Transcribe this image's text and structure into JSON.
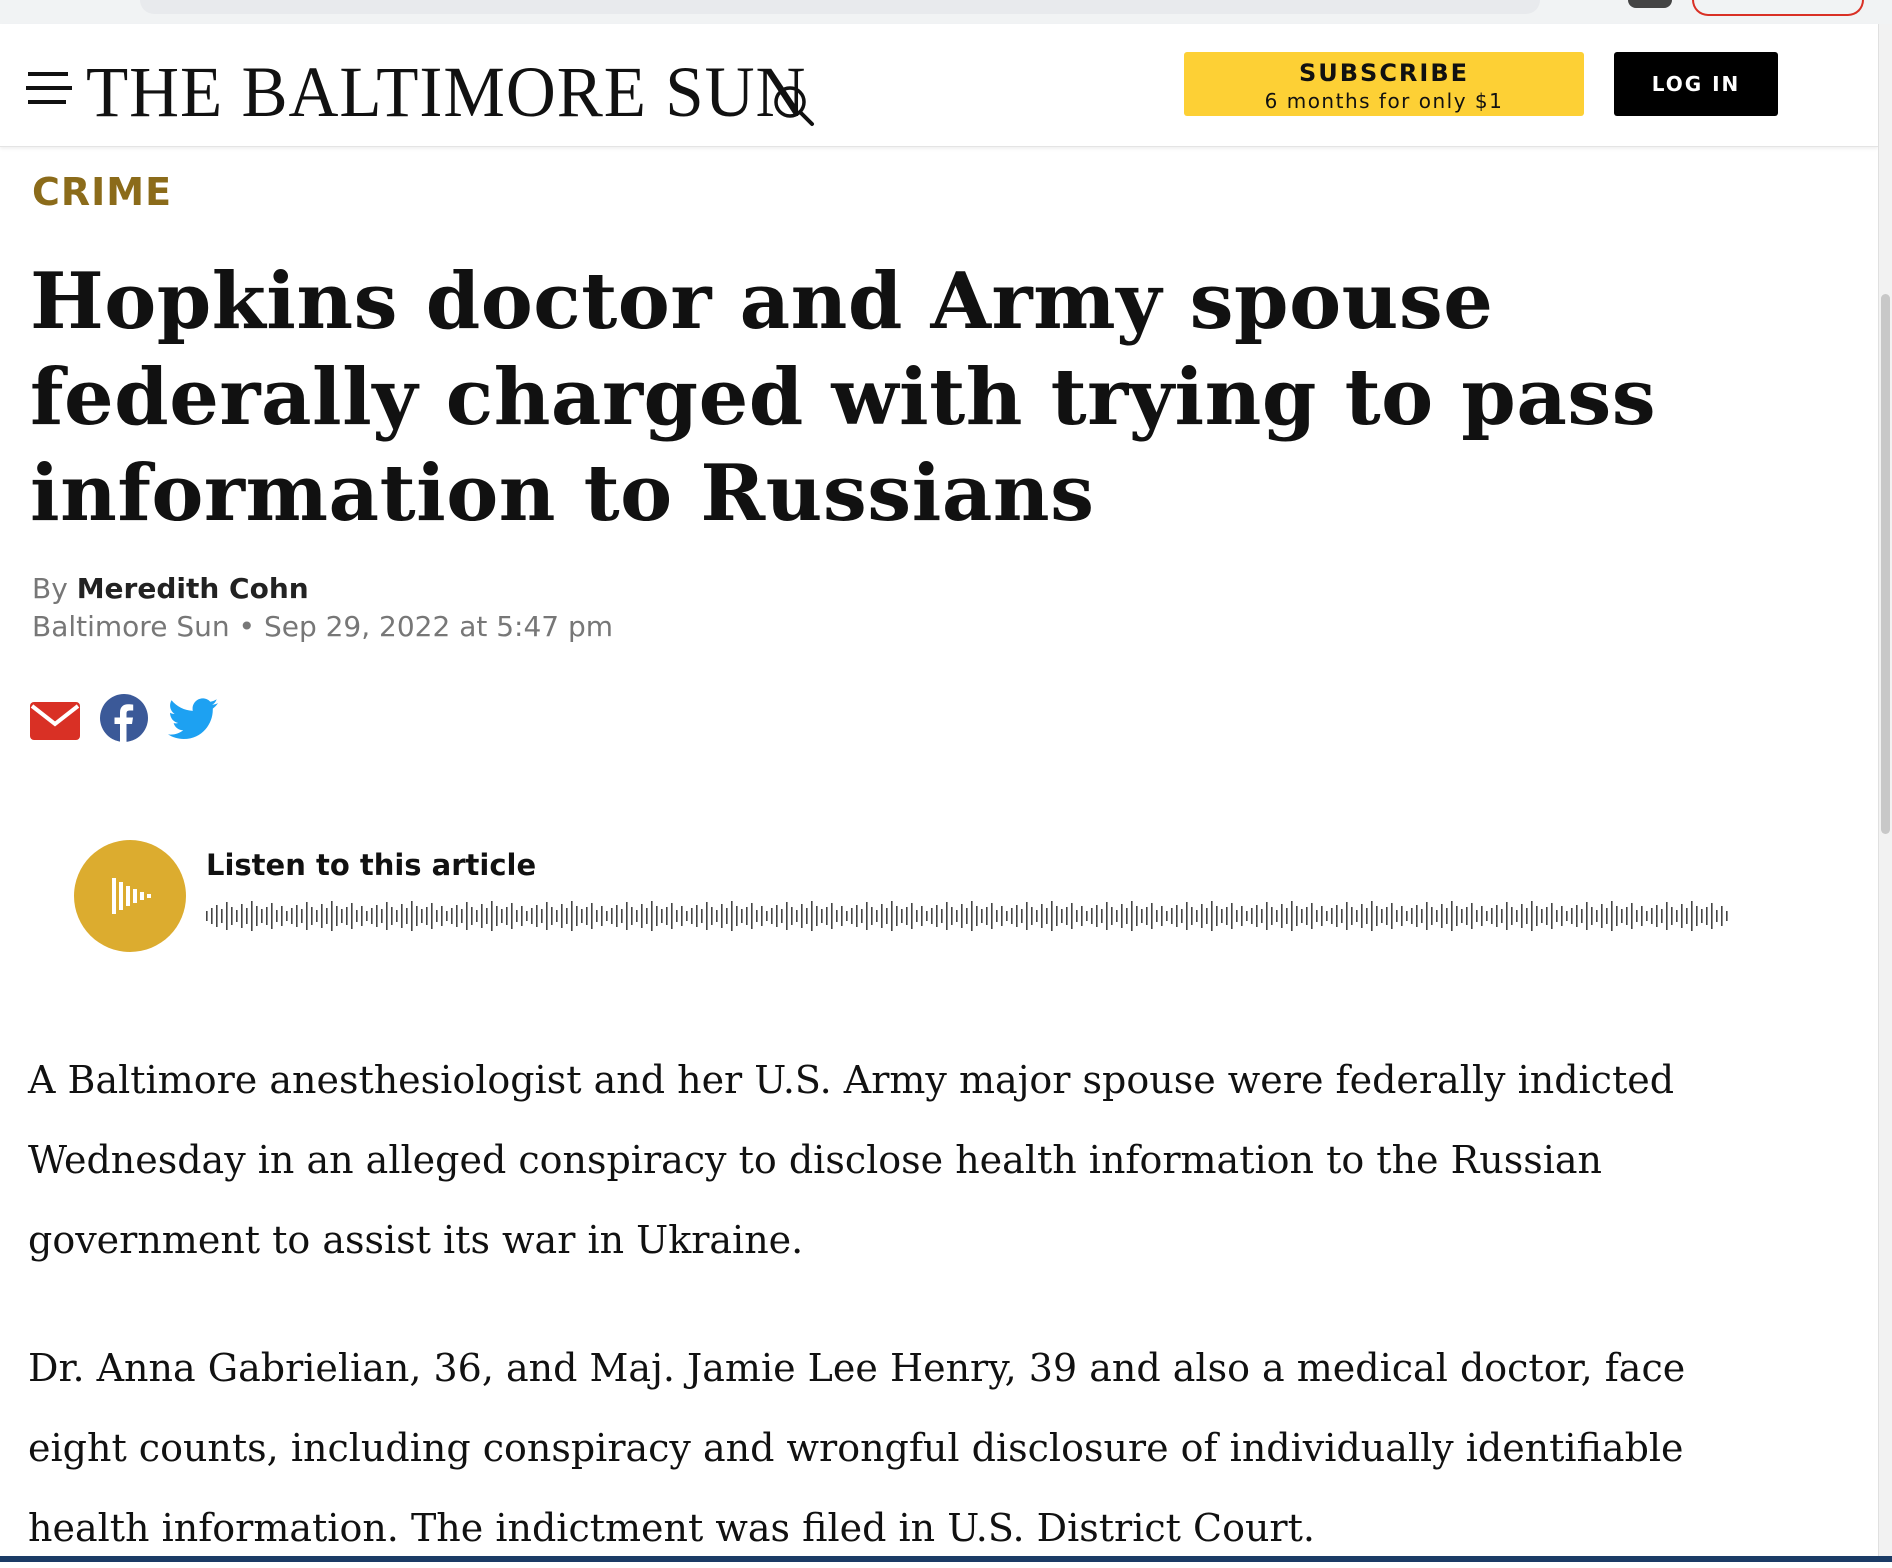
{
  "header": {
    "logo_text": "THE BALTIMORE SUN",
    "subscribe": {
      "title": "SUBSCRIBE",
      "subtitle": "6 months for only $1"
    },
    "login_label": "LOG IN"
  },
  "article": {
    "section": "CRIME",
    "headline": "Hopkins doctor and Army spouse federally charged with trying to pass information to Russians",
    "byline_prefix": "By",
    "author": "Meredith Cohn",
    "publication": "Baltimore Sun",
    "separator": "•",
    "date": "Sep 29, 2022 at 5:47 pm",
    "share_icons": [
      "email-icon",
      "facebook-icon",
      "twitter-icon"
    ],
    "audio": {
      "label": "Listen to this article"
    },
    "paragraphs": [
      "A Baltimore anesthesiologist and her U.S. Army major spouse were federally indicted Wednesday in an alleged conspiracy to disclose health information to the Russian government to assist its war in Ukraine.",
      "Dr. Anna Gabrielian, 36, and Maj. Jamie Lee Henry, 39 and also a medical doctor, face eight counts, including conspiracy and wrongful disclosure of individually identifiable health information. The indictment was filed in U.S. District Court."
    ]
  },
  "colors": {
    "section": "#8b6b1a",
    "subscribe_bg": "#fdd035",
    "login_bg": "#000000",
    "audio_button": "#dcac2f",
    "email_icon": "#d93025",
    "facebook_icon": "#3b5998",
    "twitter_icon": "#1da1f2"
  }
}
